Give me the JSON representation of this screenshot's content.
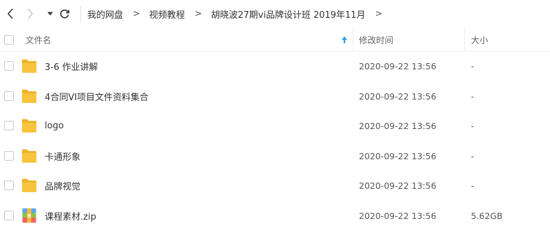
{
  "breadcrumb": [
    {
      "label": "我的网盘"
    },
    {
      "label": "视频教程"
    },
    {
      "label": "胡晓波27期vi品牌设计班 2019年11月"
    }
  ],
  "breadcrumb_separator": ">",
  "columns": {
    "name": "文件名",
    "modified": "修改时间",
    "size": "大小"
  },
  "colors": {
    "folder": "#f8c43e",
    "folder_dark": "#efb52a",
    "accent": "#2f9cf0"
  },
  "files": [
    {
      "name": "3-6 作业讲解",
      "modified": "2020-09-22 13:56",
      "size": "-",
      "type": "folder"
    },
    {
      "name": "4合同VI项目文件资料集合",
      "modified": "2020-09-22 13:56",
      "size": "-",
      "type": "folder"
    },
    {
      "name": "logo",
      "modified": "2020-09-22 13:56",
      "size": "-",
      "type": "folder"
    },
    {
      "name": "卡通形象",
      "modified": "2020-09-22 13:56",
      "size": "-",
      "type": "folder"
    },
    {
      "name": "品牌视觉",
      "modified": "2020-09-22 13:56",
      "size": "-",
      "type": "folder"
    },
    {
      "name": "课程素材.zip",
      "modified": "2020-09-22 13:56",
      "size": "5.62GB",
      "type": "zip"
    }
  ]
}
